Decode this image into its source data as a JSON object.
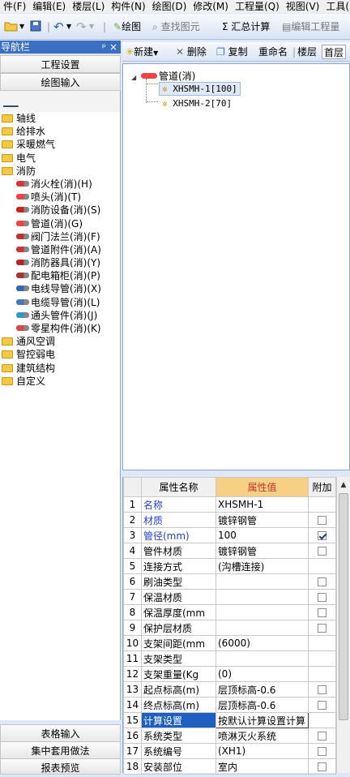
{
  "menu": [
    "件(F)",
    "编辑(E)",
    "楼层(L)",
    "构件(N)",
    "绘图(D)",
    "修改(M)",
    "工程量(Q)",
    "视图(V)",
    "工具("
  ],
  "toolbar": {
    "draw_label": "绘图",
    "find_label": "查找图元",
    "sum_label": "汇总计算",
    "edit_label": "编辑工程量"
  },
  "nav": {
    "title": "导航栏",
    "pin": "ᵖ",
    "close": "×",
    "buttons": [
      "工程设置",
      "绘图输入"
    ],
    "bottom_buttons": [
      "表格输入",
      "集中套用做法",
      "报表预览"
    ],
    "tree": [
      {
        "label": "轴线",
        "level": 0
      },
      {
        "label": "给排水",
        "level": 0
      },
      {
        "label": "采暖燃气",
        "level": 0
      },
      {
        "label": "电气",
        "level": 0
      },
      {
        "label": "消防",
        "level": 0,
        "open": true
      },
      {
        "label": "消火栓(消)(H)",
        "level": 1,
        "icon": "hydrant-icon"
      },
      {
        "label": "喷头(消)(T)",
        "level": 1,
        "icon": "sprinkler-icon"
      },
      {
        "label": "消防设备(消)(S)",
        "level": 1,
        "icon": "fire-equipment-icon"
      },
      {
        "label": "管道(消)(G)",
        "level": 1,
        "icon": "pipe-icon"
      },
      {
        "label": "阀门法兰(消)(F)",
        "level": 1,
        "icon": "valve-icon"
      },
      {
        "label": "管道附件(消)(A)",
        "level": 1,
        "icon": "pipe-fitting-icon"
      },
      {
        "label": "消防器具(消)(Y)",
        "level": 1,
        "icon": "fire-fixture-icon"
      },
      {
        "label": "配电箱柜(消)(P)",
        "level": 1,
        "icon": "distribution-box-icon"
      },
      {
        "label": "电线导管(消)(X)",
        "level": 1,
        "icon": "wire-conduit-icon"
      },
      {
        "label": "电缆导管(消)(L)",
        "level": 1,
        "icon": "cable-conduit-icon"
      },
      {
        "label": "通头管件(消)(J)",
        "level": 1,
        "icon": "tee-fitting-icon"
      },
      {
        "label": "零星构件(消)(K)",
        "level": 1,
        "icon": "misc-part-icon"
      },
      {
        "label": "通风空调",
        "level": 0
      },
      {
        "label": "智控弱电",
        "level": 0
      },
      {
        "label": "建筑结构",
        "level": 0
      },
      {
        "label": "自定义",
        "level": 0
      }
    ]
  },
  "component_toolbar": {
    "new_label": "新建",
    "delete_label": "删除",
    "copy_label": "复制",
    "rename_label": "重命名",
    "floor_label": "楼层",
    "floor_value": "首层"
  },
  "component_tree": {
    "root": "管道(消)",
    "items": [
      "XHSMH-1[100]",
      "XHSMH-2[70]"
    ],
    "selected": 0
  },
  "properties": {
    "headers": [
      "属性名称",
      "属性值",
      "附加"
    ],
    "rows": [
      {
        "n": "1",
        "name": "名称",
        "value": "XHSMH-1",
        "blue": true,
        "cb": null
      },
      {
        "n": "2",
        "name": "材质",
        "value": "镀锌钢管",
        "blue": true,
        "cb": false
      },
      {
        "n": "3",
        "name": "管径(mm)",
        "value": "100",
        "blue": true,
        "cb": true
      },
      {
        "n": "4",
        "name": "管件材质",
        "value": "镀锌钢管",
        "blue": false,
        "cb": false
      },
      {
        "n": "5",
        "name": "连接方式",
        "value": "(沟槽连接)",
        "blue": false,
        "cb": null
      },
      {
        "n": "6",
        "name": "刷油类型",
        "value": "",
        "blue": false,
        "cb": false
      },
      {
        "n": "7",
        "name": "保温材质",
        "value": "",
        "blue": false,
        "cb": false
      },
      {
        "n": "8",
        "name": "保温厚度(mm",
        "value": "",
        "blue": false,
        "cb": false
      },
      {
        "n": "9",
        "name": "保护层材质",
        "value": "",
        "blue": false,
        "cb": false
      },
      {
        "n": "10",
        "name": "支架间距(mm",
        "value": "(6000)",
        "blue": false,
        "cb": null
      },
      {
        "n": "11",
        "name": "支架类型",
        "value": "",
        "blue": false,
        "cb": null
      },
      {
        "n": "12",
        "name": "支架重量(Kg",
        "value": "(0)",
        "blue": false,
        "cb": null
      },
      {
        "n": "13",
        "name": "起点标高(m)",
        "value": "层顶标高-0.6",
        "blue": false,
        "cb": false
      },
      {
        "n": "14",
        "name": "终点标高(m)",
        "value": "层顶标高-0.6",
        "blue": false,
        "cb": false
      },
      {
        "n": "15",
        "name": "计算设置",
        "value": "按默认计算设置计算",
        "blue": false,
        "cb": null,
        "selected": true
      },
      {
        "n": "16",
        "name": "系统类型",
        "value": "喷淋灭火系统",
        "blue": false,
        "cb": false
      },
      {
        "n": "17",
        "name": "系统编号",
        "value": "(XH1)",
        "blue": false,
        "cb": false
      },
      {
        "n": "18",
        "name": "安装部位",
        "value": "室内",
        "blue": false,
        "cb": false
      }
    ]
  },
  "colors": {
    "nav_title_bg": "#3b6fc2",
    "header_highlight": "#f7cf85",
    "selection": "#1f5fbf",
    "required_text": "#2340c8"
  }
}
